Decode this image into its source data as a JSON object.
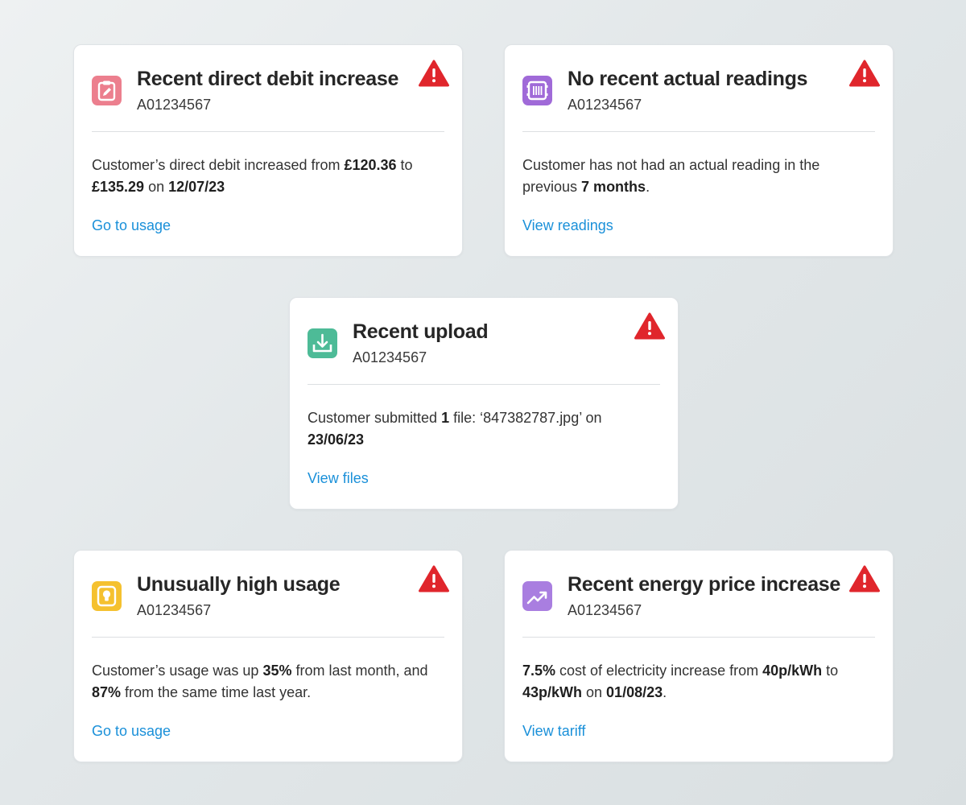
{
  "colors": {
    "alert": "#e0262c",
    "link": "#1a90d9",
    "debit_icon": "#ec7f8e",
    "readings_icon": "#a06ad8",
    "upload_icon": "#4dbb97",
    "usage_icon": "#f5c12f",
    "price_icon": "#a97ee0"
  },
  "cards": [
    {
      "title": "Recent direct debit increase",
      "account": "A01234567",
      "icon": "clipboard-edit-icon",
      "body": [
        {
          "t": "Customer’s direct debit increased from "
        },
        {
          "t": "£120.36",
          "b": true
        },
        {
          "t": " to "
        },
        {
          "t": "£135.29",
          "b": true
        },
        {
          "t": " on "
        },
        {
          "t": "12/07/23",
          "b": true
        }
      ],
      "link": "Go to usage"
    },
    {
      "title": "No recent actual readings",
      "account": "A01234567",
      "icon": "meter-icon",
      "body": [
        {
          "t": "Customer has not had an actual reading in the previous "
        },
        {
          "t": "7 months",
          "b": true
        },
        {
          "t": "."
        }
      ],
      "link": "View readings"
    },
    {
      "title": "Recent upload",
      "account": "A01234567",
      "icon": "download-tray-icon",
      "body": [
        {
          "t": "Customer submitted "
        },
        {
          "t": "1",
          "b": true
        },
        {
          "t": " file: ‘847382787.jpg’ on "
        },
        {
          "t": "23/06/23",
          "b": true
        }
      ],
      "link": "View files"
    },
    {
      "title": "Unusually high usage",
      "account": "A01234567",
      "icon": "lightbulb-icon",
      "body": [
        {
          "t": "Customer’s usage was up "
        },
        {
          "t": "35%",
          "b": true
        },
        {
          "t": " from last month, and "
        },
        {
          "t": "87%",
          "b": true
        },
        {
          "t": " from the same time last year."
        }
      ],
      "link": "Go to usage"
    },
    {
      "title": "Recent energy price increase",
      "account": "A01234567",
      "icon": "trend-up-icon",
      "body": [
        {
          "t": "7.5%",
          "b": true
        },
        {
          "t": " cost of electricity increase from "
        },
        {
          "t": "40p/kWh",
          "b": true
        },
        {
          "t": " to "
        },
        {
          "t": "43p/kWh",
          "b": true
        },
        {
          "t": " on "
        },
        {
          "t": "01/08/23",
          "b": true
        },
        {
          "t": "."
        }
      ],
      "link": "View tariff"
    }
  ]
}
